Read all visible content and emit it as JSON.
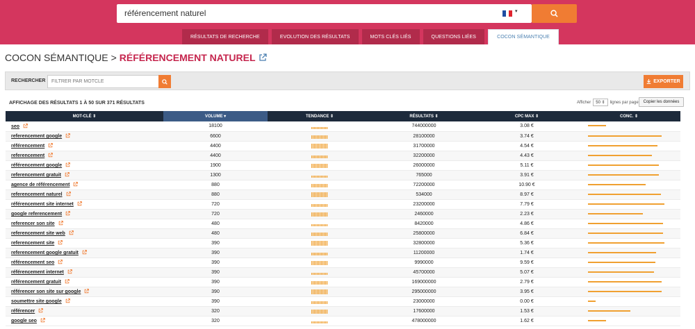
{
  "search": {
    "query": "référencement naturel",
    "flag_colors": [
      "#1f4ea3",
      "#ffffff",
      "#e0232e"
    ]
  },
  "tabs": [
    {
      "label": "RÉSULTATS DE RECHERCHE",
      "active": false
    },
    {
      "label": "EVOLUTION DES RÉSULTATS",
      "active": false
    },
    {
      "label": "MOTS CLÉS LIÉS",
      "active": false
    },
    {
      "label": "QUESTIONS LIÉES",
      "active": false
    },
    {
      "label": "COCON SÉMANTIQUE",
      "active": true
    }
  ],
  "page": {
    "title_prefix": "COCON SÉMANTIQUE",
    "separator": ">",
    "title_keyword": "RÉFÉRENCEMENT NATUREL"
  },
  "filter": {
    "label": "RECHERCHER :",
    "placeholder": "FILTRER PAR MOTCLE",
    "export_label": "EXPORTER"
  },
  "info": {
    "summary": "AFFICHAGE DES RÉSULTATS 1 À 50 SUR 371 RÉSULTATS",
    "show_label": "Afficher",
    "page_size": "50",
    "per_page_label": "lignes par page",
    "copy_label": "Copier les données"
  },
  "columns": [
    "MOT-CLÉ ⇕",
    "VOLUME ▾",
    "TENDANCE ⇕",
    "RÉSULTATS ⇕",
    "CPC MAX ⇕",
    "CONC. ⇕"
  ],
  "colors": {
    "accent": "#d4365e",
    "orange": "#f07c33",
    "header": "#1d2a3b",
    "sorted_header": "#3c5b86",
    "keyword": "#c5254d"
  },
  "rows": [
    {
      "keyword": "seo",
      "volume": "18100",
      "results": "744000000",
      "cpc": "3.08 €",
      "competition": 0.24
    },
    {
      "keyword": "referencement google",
      "volume": "6600",
      "results": "28100000",
      "cpc": "3.74 €",
      "competition": 0.96
    },
    {
      "keyword": "référencement",
      "volume": "4400",
      "results": "31700000",
      "cpc": "4.54 €",
      "competition": 0.91
    },
    {
      "keyword": "referencement",
      "volume": "4400",
      "results": "32200000",
      "cpc": "4.43 €",
      "competition": 0.84
    },
    {
      "keyword": "référencement google",
      "volume": "1900",
      "results": "26000000",
      "cpc": "5.11 €",
      "competition": 0.93
    },
    {
      "keyword": "referencement gratuit",
      "volume": "1300",
      "results": "765000",
      "cpc": "3.91 €",
      "competition": 0.93
    },
    {
      "keyword": "agence de référencement",
      "volume": "880",
      "results": "72200000",
      "cpc": "10.90 €",
      "competition": 0.75
    },
    {
      "keyword": "referencement naturel",
      "volume": "880",
      "results": "534000",
      "cpc": "8.97 €",
      "competition": 0.95
    },
    {
      "keyword": "référencement site internet",
      "volume": "720",
      "results": "23200000",
      "cpc": "7.79 €",
      "competition": 1.0
    },
    {
      "keyword": "google referencement",
      "volume": "720",
      "results": "2460000",
      "cpc": "2.23 €",
      "competition": 0.72
    },
    {
      "keyword": "referencer son site",
      "volume": "480",
      "results": "8420000",
      "cpc": "4.86 €",
      "competition": 0.98
    },
    {
      "keyword": "referencement site web",
      "volume": "480",
      "results": "25800000",
      "cpc": "6.84 €",
      "competition": 0.98
    },
    {
      "keyword": "referencement site",
      "volume": "390",
      "results": "32800000",
      "cpc": "5.36 €",
      "competition": 1.0
    },
    {
      "keyword": "referencement google gratuit",
      "volume": "390",
      "results": "11200000",
      "cpc": "1.74 €",
      "competition": 0.89
    },
    {
      "keyword": "référencement seo",
      "volume": "390",
      "results": "9990000",
      "cpc": "9.59 €",
      "competition": 0.88
    },
    {
      "keyword": "référencement internet",
      "volume": "390",
      "results": "45700000",
      "cpc": "5.07 €",
      "competition": 0.86
    },
    {
      "keyword": "référencement gratuit",
      "volume": "390",
      "results": "169000000",
      "cpc": "2.79 €",
      "competition": 0.96
    },
    {
      "keyword": "référencer son site sur google",
      "volume": "390",
      "results": "295000000",
      "cpc": "3.95 €",
      "competition": 0.96
    },
    {
      "keyword": "soumettre site google",
      "volume": "390",
      "results": "23000000",
      "cpc": "0.00 €",
      "competition": 0.1
    },
    {
      "keyword": "référencer",
      "volume": "320",
      "results": "17600000",
      "cpc": "1.53 €",
      "competition": 0.55
    },
    {
      "keyword": "google seo",
      "volume": "320",
      "results": "478000000",
      "cpc": "1.62 €",
      "competition": 0.24
    }
  ]
}
